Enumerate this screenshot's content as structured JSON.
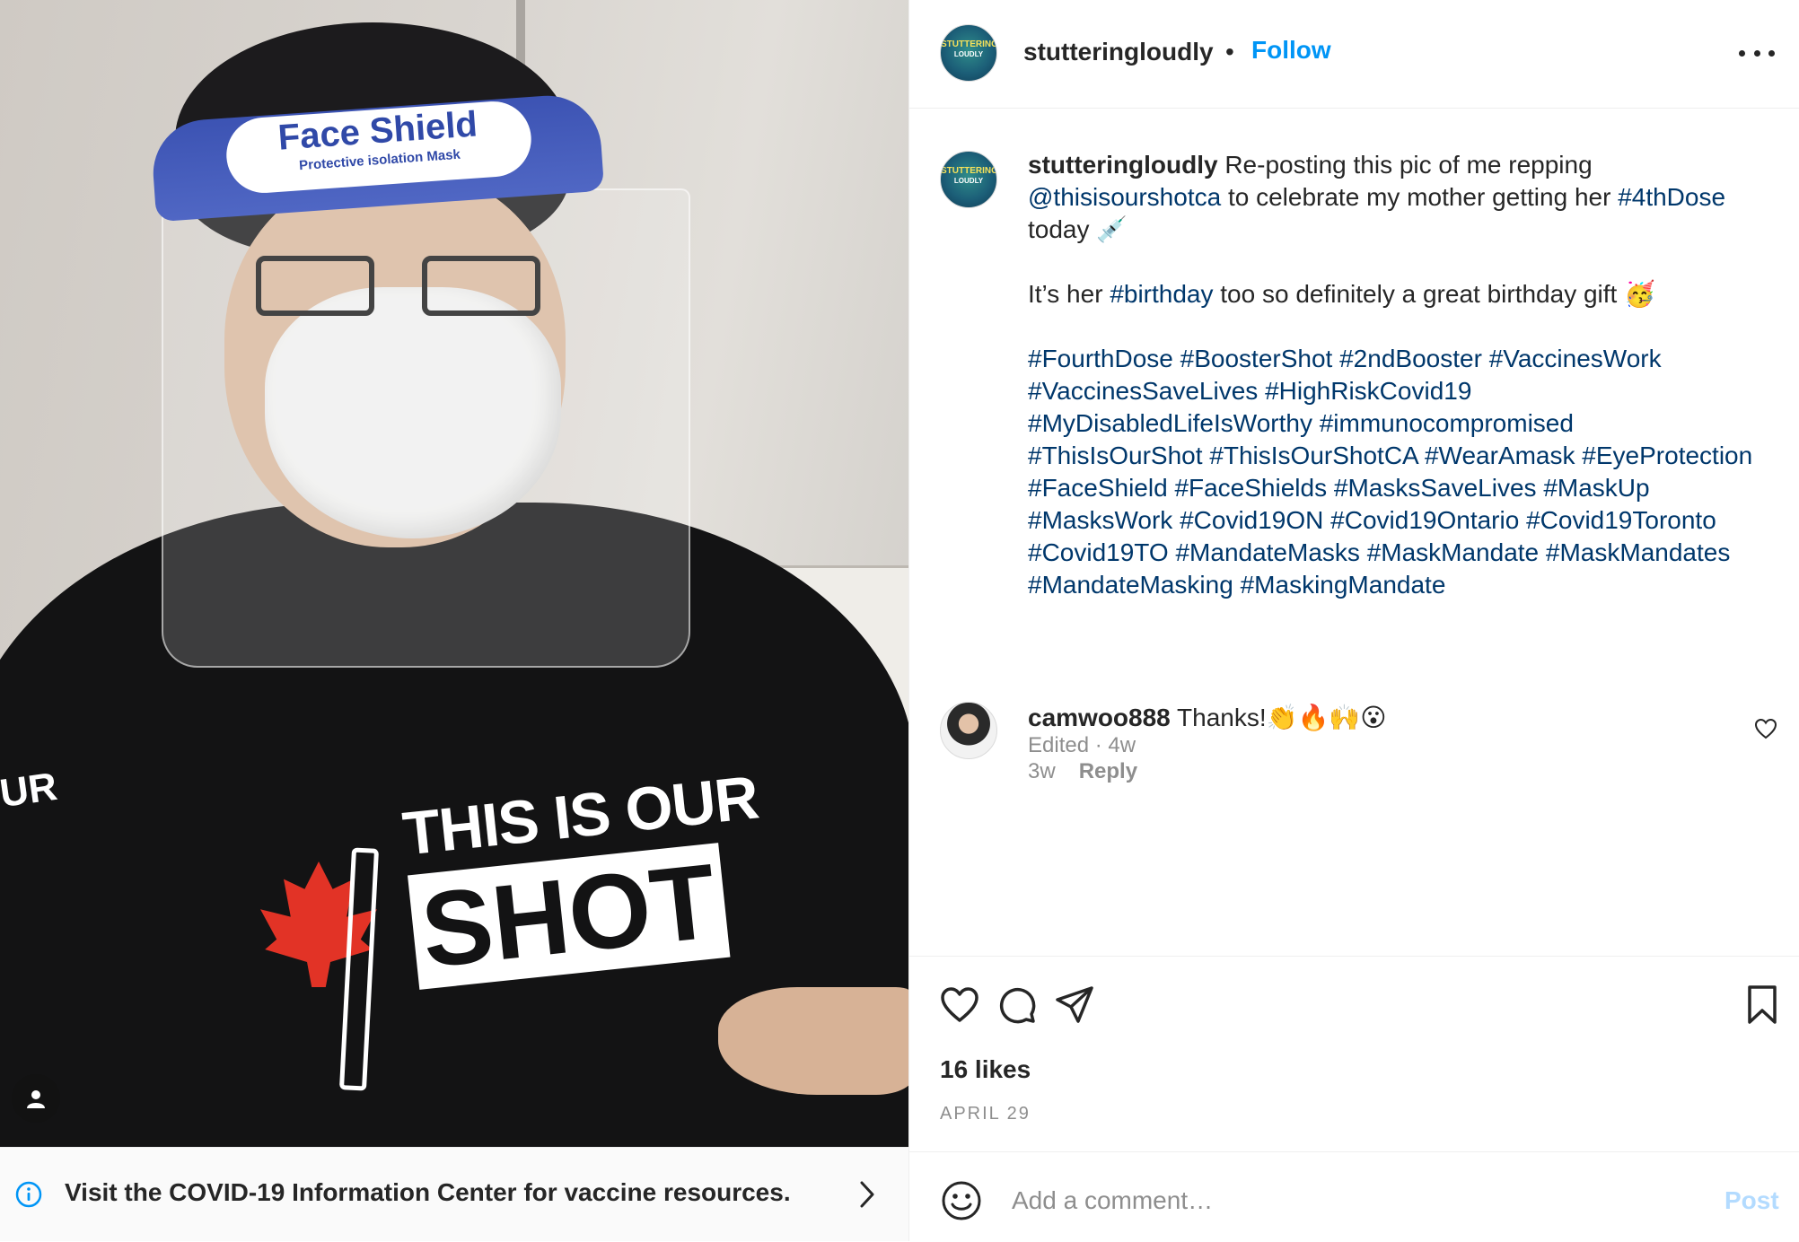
{
  "photo": {
    "shield_title": "Face Shield",
    "shield_subtitle": "Protective isolation Mask",
    "shirt_line1": "THIS IS OUR",
    "shirt_line2": "SHOT",
    "sleeve_text": "UR"
  },
  "info_bar": {
    "icon": "info-icon",
    "text": "Visit the COVID-19 Information Center for vaccine resources."
  },
  "header": {
    "username": "stutteringloudly",
    "separator": "•",
    "follow_label": "Follow",
    "avatar_text_line1": "STUTTERING",
    "avatar_text_line2": "LOUDLY"
  },
  "caption": {
    "username": "stutteringloudly",
    "text_1": " Re-posting this pic of me repping ",
    "mention": "@thisisourshotca",
    "text_2": " to celebrate my mother getting her ",
    "tag_4thdose": "#4thDose",
    "text_3": " today 💉\n\nIt’s her ",
    "tag_birthday": "#birthday",
    "text_4": " too so definitely a great birthday gift 🥳\n\n",
    "hashtags": [
      "#FourthDose",
      "#BoosterShot",
      "#2ndBooster",
      "#VaccinesWork",
      "#VaccinesSaveLives",
      "#HighRiskCovid19",
      "#MyDisabledLifeIsWorthy",
      "#immunocompromised",
      "#ThisIsOurShot",
      "#ThisIsOurShotCA",
      "#WearAmask",
      "#EyeProtection",
      "#FaceShield",
      "#FaceShields",
      "#MasksSaveLives",
      "#MaskUp",
      "#MasksWork",
      "#Covid19ON",
      "#Covid19Ontario",
      "#Covid19Toronto",
      "#Covid19TO",
      "#MandateMasks",
      "#MaskMandate",
      "#MaskMandates",
      "#MandateMasking",
      "#MaskingMandate"
    ],
    "meta": "Edited · 4w"
  },
  "comment": {
    "username": "camwoo888",
    "text": " Thanks!👏🔥🙌😮",
    "time": "3w",
    "reply_label": "Reply"
  },
  "actions": {
    "likes": "16 likes",
    "date": "APRIL 29"
  },
  "comment_box": {
    "placeholder": "Add a comment…",
    "post_label": "Post"
  },
  "colors": {
    "link": "#00376b",
    "follow": "#0095f6",
    "post_disabled": "#b3dbff",
    "muted": "#8e8e8e"
  }
}
